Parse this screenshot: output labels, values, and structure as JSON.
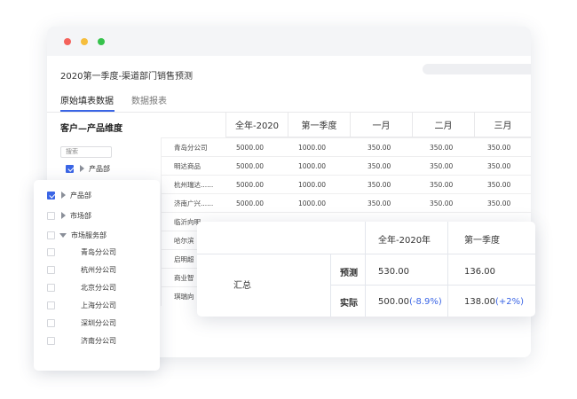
{
  "window": {
    "title": "2020第一季度-渠道部门销售预测",
    "tabs": [
      {
        "label": "原始填表数据",
        "active": true
      },
      {
        "label": "数据报表",
        "active": false
      }
    ],
    "dimension_title": "客户—产品维度",
    "columns": [
      "全年-2020",
      "第一季度",
      "一月",
      "二月",
      "三月"
    ],
    "rows": [
      {
        "name": "青岛分公司",
        "values": [
          "5000.00",
          "1000.00",
          "350.00",
          "350.00",
          "350.00"
        ]
      },
      {
        "name": "明达商品",
        "values": [
          "5000.00",
          "1000.00",
          "350.00",
          "350.00",
          "350.00"
        ]
      },
      {
        "name": "杭州瑞达......",
        "values": [
          "5000.00",
          "1000.00",
          "350.00",
          "350.00",
          "350.00"
        ]
      },
      {
        "name": "济南广兴......",
        "values": [
          "5000.00",
          "1000.00",
          "350.00",
          "350.00",
          "350.00"
        ]
      },
      {
        "name": "临沂向明",
        "values": []
      },
      {
        "name": "哈尔滨",
        "values": []
      },
      {
        "name": "启明超",
        "values": []
      },
      {
        "name": "商业智",
        "values": []
      },
      {
        "name": "琪瑞向",
        "values": []
      }
    ],
    "mini_tree": {
      "search_placeholder": "搜索",
      "item": {
        "label": "产品部",
        "checked": true
      }
    }
  },
  "tree_panel": {
    "items": [
      {
        "label": "产品部",
        "checked": true,
        "expander": "collapsed",
        "level": 0
      },
      {
        "label": "市场部",
        "checked": false,
        "expander": "collapsed",
        "level": 0
      },
      {
        "label": "市场服务部",
        "checked": false,
        "expander": "expanded",
        "level": 0
      },
      {
        "label": "青岛分公司",
        "checked": false,
        "expander": "none",
        "level": 1
      },
      {
        "label": "杭州分公司",
        "checked": false,
        "expander": "none",
        "level": 1
      },
      {
        "label": "北京分公司",
        "checked": false,
        "expander": "none",
        "level": 1
      },
      {
        "label": "上海分公司",
        "checked": false,
        "expander": "none",
        "level": 1
      },
      {
        "label": "深圳分公司",
        "checked": false,
        "expander": "none",
        "level": 1
      },
      {
        "label": "济南分公司",
        "checked": false,
        "expander": "none",
        "level": 1
      }
    ]
  },
  "summary": {
    "headers": [
      "全年-2020年",
      "第一季度"
    ],
    "group_label": "汇总",
    "forecast": {
      "label": "预测",
      "values": [
        "530.00",
        "136.00"
      ]
    },
    "actual": {
      "label": "实际",
      "values": [
        {
          "value": "500.00",
          "change": "(-8.9%)"
        },
        {
          "value": "138.00",
          "change": "(+2%)"
        }
      ]
    }
  },
  "colors": {
    "accent": "#3a65e5",
    "dot_red": "#f4625b",
    "dot_yellow": "#f6be3c",
    "dot_green": "#36c24c"
  }
}
